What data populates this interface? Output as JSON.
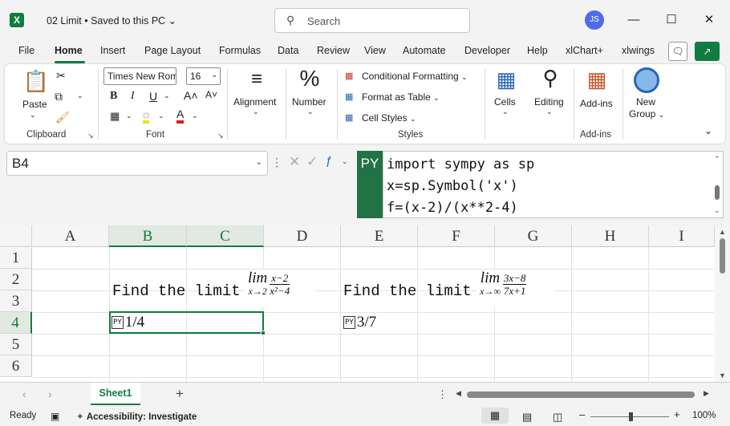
{
  "titlebar": {
    "doc_title": "02 Limit • Saved to this PC ⌄",
    "search_placeholder": "Search",
    "user_initials": "JS",
    "minimize": "—",
    "maximize": "☐",
    "close": "✕"
  },
  "tabs": [
    "File",
    "Home",
    "Insert",
    "Page Layout",
    "Formulas",
    "Data",
    "Review",
    "View",
    "Automate",
    "Developer",
    "Help",
    "xlChart+",
    "xlwings"
  ],
  "ribbon": {
    "clipboard": {
      "paste": "Paste",
      "label": "Clipboard"
    },
    "font": {
      "name": "Times New Rom",
      "size": "16",
      "label": "Font",
      "bold": "B",
      "italic": "I",
      "underline": "U",
      "grow": "A˄",
      "shrink": "A˅"
    },
    "alignment": {
      "label": "Alignment"
    },
    "number": {
      "label": "Number",
      "icon": "%"
    },
    "styles": {
      "conditional": "Conditional Formatting",
      "table": "Format as Table",
      "cell": "Cell Styles",
      "label": "Styles"
    },
    "cells": {
      "label": "Cells"
    },
    "editing": {
      "label": "Editing"
    },
    "addins": {
      "addins": "Add-ins",
      "label": "Add-ins"
    },
    "newgroup": {
      "line1": "New",
      "line2": "Group"
    }
  },
  "formula_bar": {
    "name_box": "B4",
    "py_badge": "PY",
    "code_lines": [
      "import sympy as sp",
      "x=sp.Symbol('x')",
      "f=(x-2)/(x**2-4)"
    ]
  },
  "grid": {
    "columns": [
      "A",
      "B",
      "C",
      "D",
      "E",
      "F",
      "G",
      "H",
      "I"
    ],
    "rows": [
      "1",
      "2",
      "3",
      "4",
      "5",
      "6"
    ],
    "selected_column": "B",
    "selected_row": "4",
    "cells": {
      "B2": "Find the limit",
      "E2": "Find the limit",
      "B4_icon": "PY",
      "B4": "1/4",
      "E4_icon": "PY",
      "E4": "3/7"
    },
    "math1": {
      "lim": "lim",
      "sub": "x→2",
      "num": "x−2",
      "den": "x²−4"
    },
    "math2": {
      "lim": "lim",
      "sub": "x→∞",
      "num": "3x−8",
      "den": "7x+1"
    }
  },
  "sheet_tabs": {
    "active": "Sheet1",
    "add": "+"
  },
  "status": {
    "ready": "Ready",
    "accessibility": "Accessibility: Investigate",
    "zoom": "100%"
  }
}
